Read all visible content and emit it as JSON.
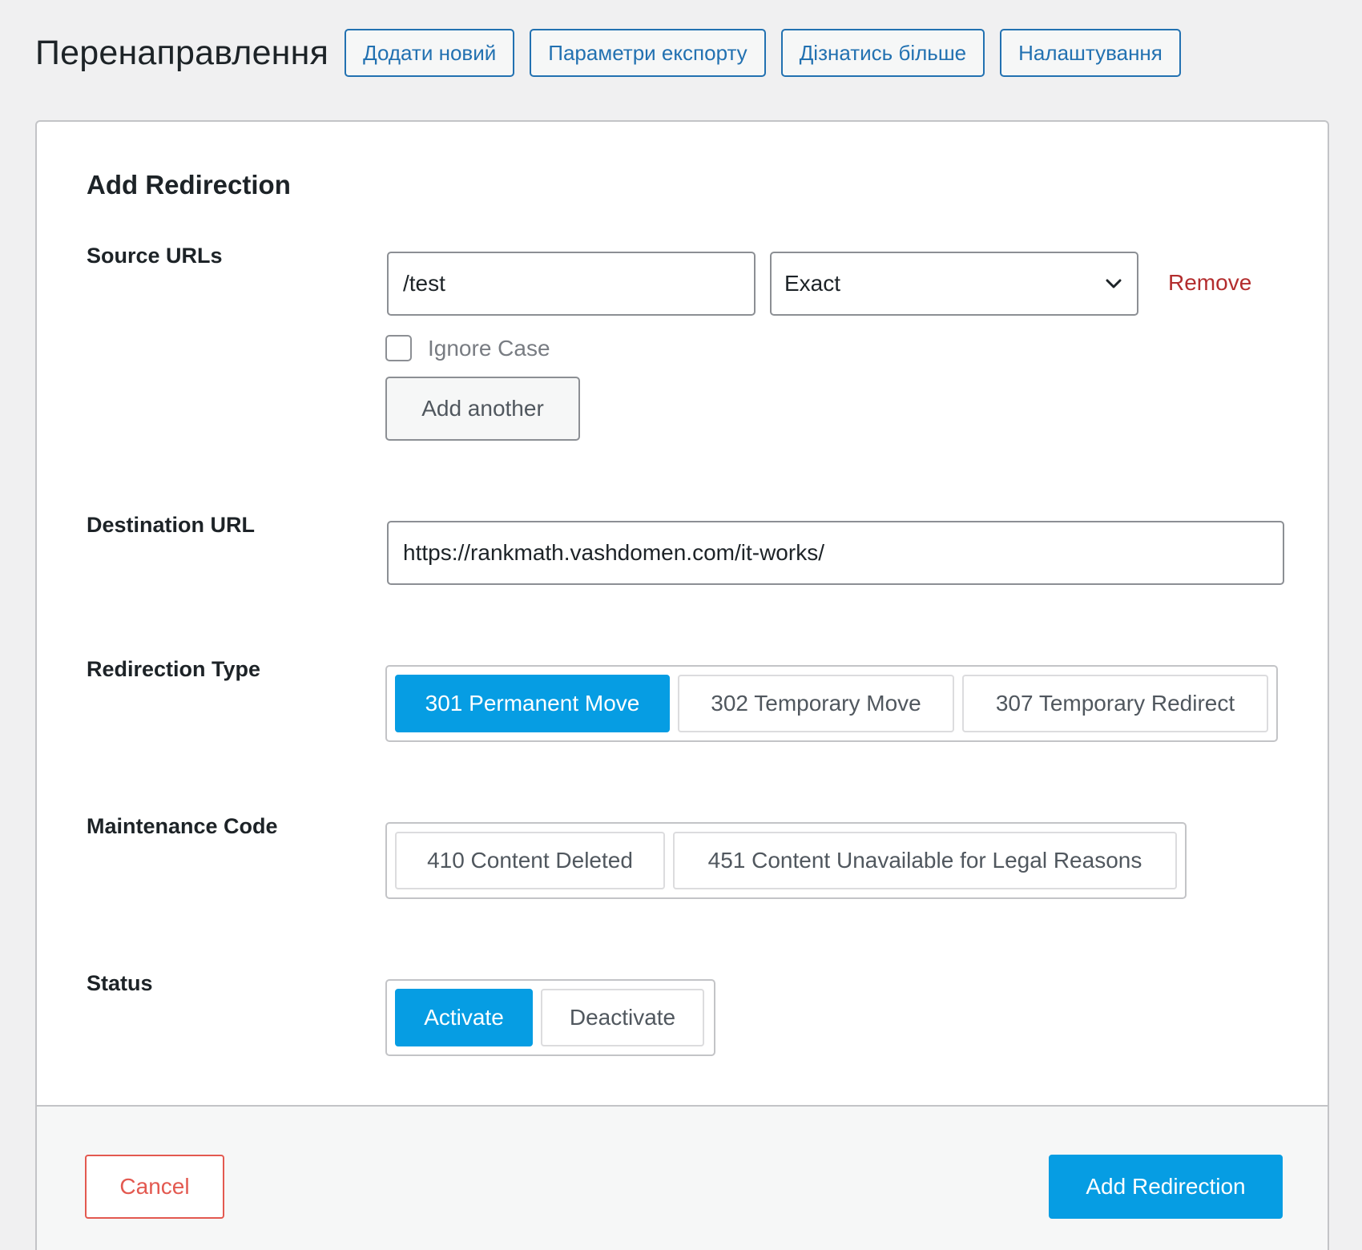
{
  "header": {
    "title": "Перенаправлення",
    "buttons": [
      {
        "label": "Додати новий"
      },
      {
        "label": "Параметри експорту"
      },
      {
        "label": "Дізнатись більше"
      },
      {
        "label": "Налаштування"
      }
    ]
  },
  "form": {
    "title": "Add Redirection",
    "source": {
      "label": "Source URLs",
      "url_value": "/test",
      "match_type": "Exact",
      "remove_label": "Remove",
      "ignore_case_label": "Ignore Case",
      "ignore_case_checked": false,
      "add_another_label": "Add another"
    },
    "destination": {
      "label": "Destination URL",
      "value": "https://rankmath.vashdomen.com/it-works/"
    },
    "redirection_type": {
      "label": "Redirection Type",
      "options": [
        "301 Permanent Move",
        "302 Temporary Move",
        "307 Temporary Redirect"
      ],
      "selected": "301 Permanent Move"
    },
    "maintenance_code": {
      "label": "Maintenance Code",
      "options": [
        "410 Content Deleted",
        "451 Content Unavailable for Legal Reasons"
      ]
    },
    "status": {
      "label": "Status",
      "options": [
        "Activate",
        "Deactivate"
      ],
      "selected": "Activate"
    }
  },
  "footer": {
    "cancel_label": "Cancel",
    "submit_label": "Add Redirection"
  },
  "colors": {
    "accent": "#069de3",
    "link": "#2271b1",
    "danger": "#b32d2e",
    "cancel": "#e35950"
  }
}
